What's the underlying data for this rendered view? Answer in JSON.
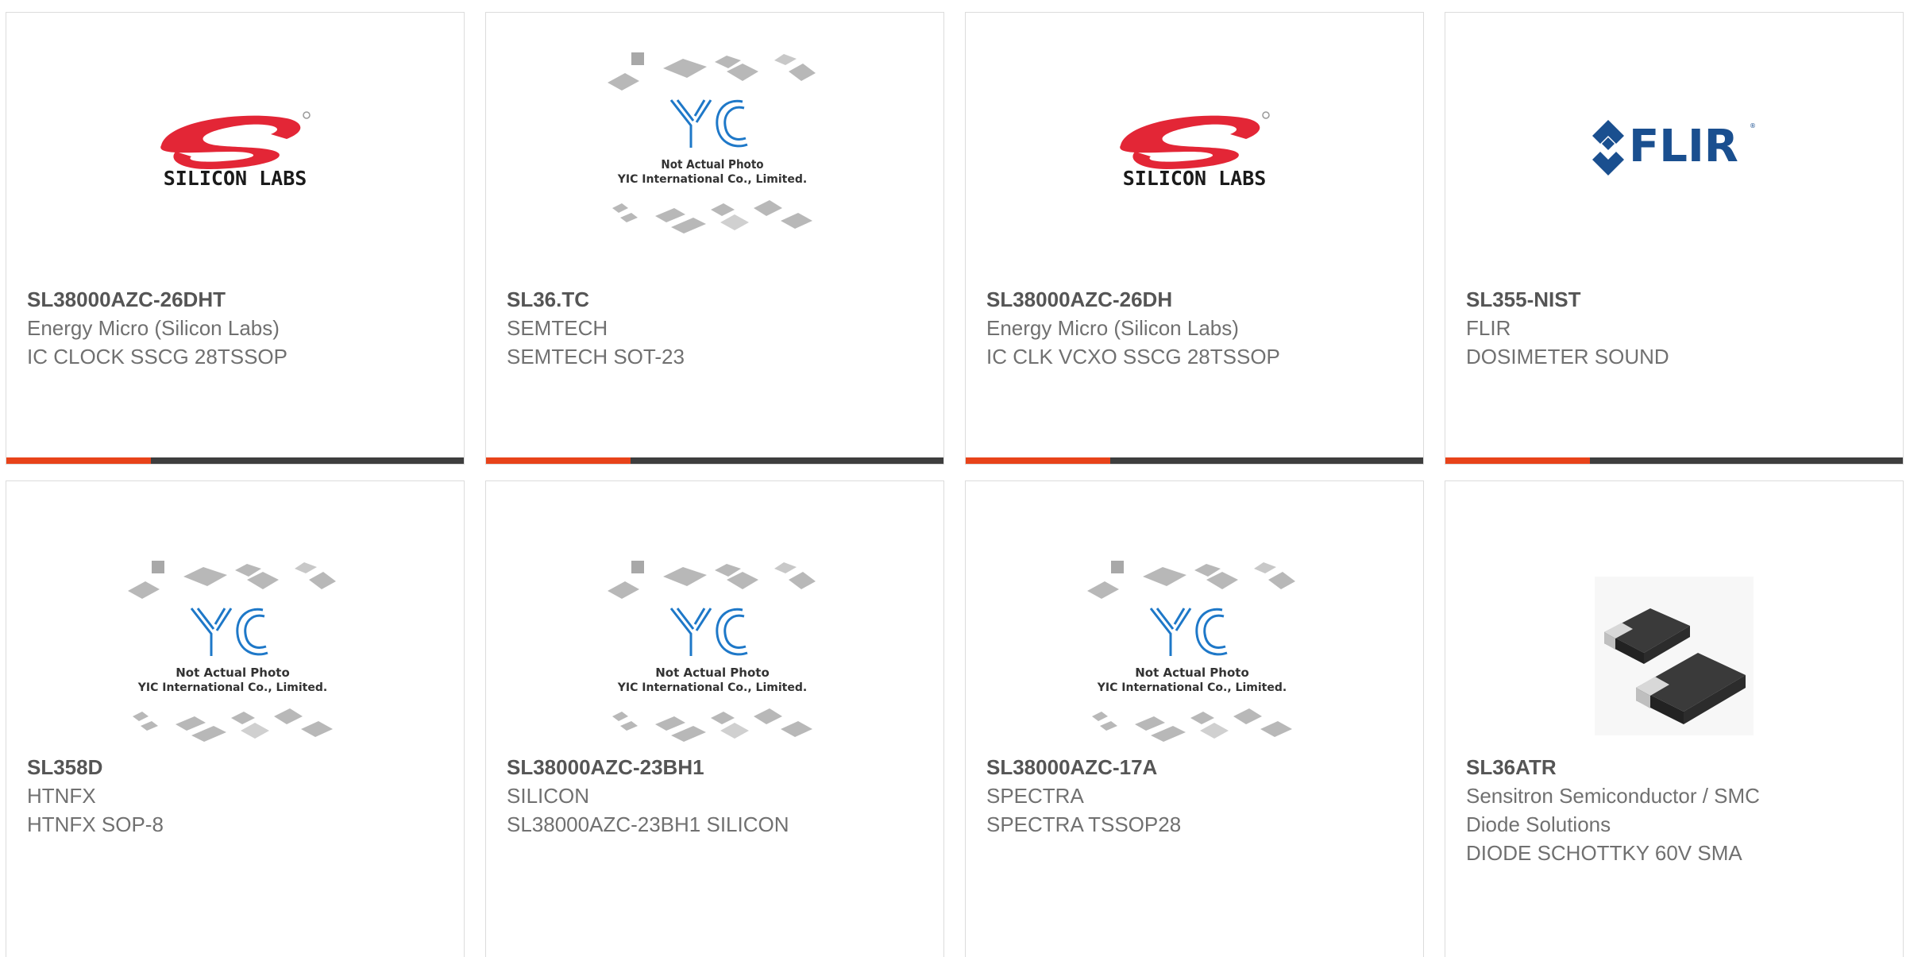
{
  "colors": {
    "accent": "#e8431a",
    "bar": "#3e3e3e",
    "silicon_red": "#e32636",
    "flir_blue": "#1a4f8f",
    "yic_blue": "#1e78c8"
  },
  "products": [
    {
      "part": "SL38000AZC-26DHT",
      "lines": [
        "Energy Micro (Silicon Labs)",
        "IC CLOCK SSCG 28TSSOP"
      ],
      "image": "silicon-labs-logo",
      "logo_text": "SILICON LABS"
    },
    {
      "part": "SL36.TC",
      "lines": [
        "SEMTECH",
        "SEMTECH SOT-23"
      ],
      "image": "yic-placeholder",
      "placeholder_text": [
        "Not Actual Photo",
        "YIC International Co., Limited."
      ]
    },
    {
      "part": "SL38000AZC-26DH",
      "lines": [
        "Energy Micro (Silicon Labs)",
        "IC CLK VCXO SSCG 28TSSOP"
      ],
      "image": "silicon-labs-logo",
      "logo_text": "SILICON LABS"
    },
    {
      "part": "SL355-NIST",
      "lines": [
        "FLIR",
        "DOSIMETER SOUND"
      ],
      "image": "flir-logo",
      "logo_text": "FLIR"
    },
    {
      "part": "SL358D",
      "lines": [
        "HTNFX",
        "HTNFX SOP-8"
      ],
      "image": "yic-placeholder",
      "placeholder_text": [
        "Not Actual Photo",
        "YIC International Co., Limited."
      ]
    },
    {
      "part": "SL38000AZC-23BH1",
      "lines": [
        "SILICON",
        "SL38000AZC-23BH1 SILICON"
      ],
      "image": "yic-placeholder",
      "placeholder_text": [
        "Not Actual Photo",
        "YIC International Co., Limited."
      ]
    },
    {
      "part": "SL38000AZC-17A",
      "lines": [
        "SPECTRA",
        "SPECTRA TSSOP28"
      ],
      "image": "yic-placeholder",
      "placeholder_text": [
        "Not Actual Photo",
        "YIC International Co., Limited."
      ]
    },
    {
      "part": "SL36ATR",
      "lines": [
        "Sensitron Semiconductor / SMC",
        "Diode Solutions",
        "DIODE SCHOTTKY 60V SMA"
      ],
      "image": "diode-photo"
    }
  ]
}
